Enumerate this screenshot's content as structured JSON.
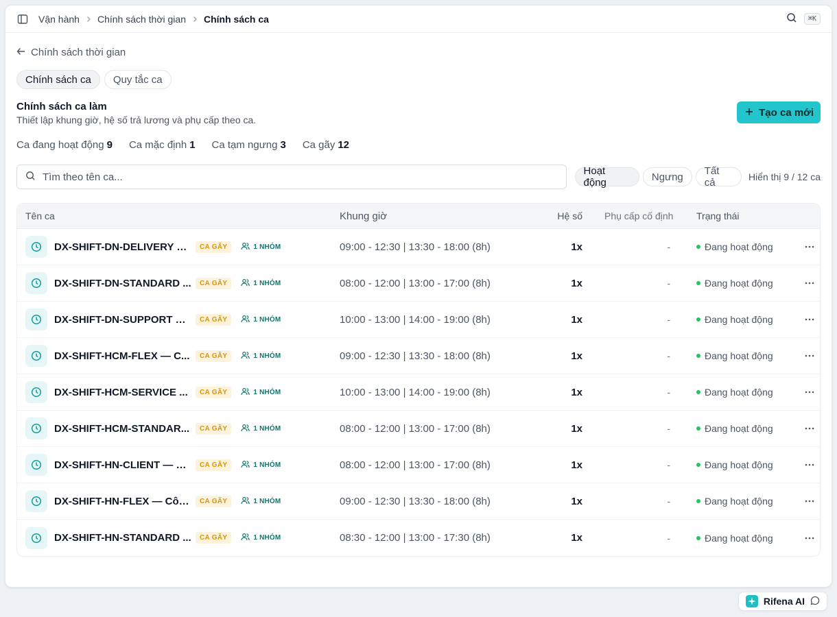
{
  "breadcrumb": [
    "Vận hành",
    "Chính sách thời gian",
    "Chính sách ca"
  ],
  "shortcut": "⌘K",
  "back_label": "Chính sách thời gian",
  "tabs": [
    {
      "label": "Chính sách ca",
      "active": true
    },
    {
      "label": "Quy tắc ca",
      "active": false
    }
  ],
  "page": {
    "title": "Chính sách ca làm",
    "subtitle": "Thiết lập khung giờ, hệ số trả lương và phụ cấp theo ca.",
    "create_label": "Tạo ca mới"
  },
  "stats": [
    {
      "label": "Ca đang hoạt động",
      "value": "9"
    },
    {
      "label": "Ca mặc định",
      "value": "1"
    },
    {
      "label": "Ca tạm ngưng",
      "value": "3"
    },
    {
      "label": "Ca gãy",
      "value": "12"
    }
  ],
  "search": {
    "placeholder": "Tìm theo tên ca..."
  },
  "filters": [
    {
      "label": "Hoạt động",
      "active": true
    },
    {
      "label": "Ngưng",
      "active": false
    },
    {
      "label": "Tất cả",
      "active": false
    }
  ],
  "showing": "Hiển thị 9 / 12 ca",
  "columns": {
    "name": "Tên ca",
    "time": "Khung giờ",
    "coef": "Hệ số",
    "allowance": "Phụ cấp cố định",
    "status": "Trạng thái"
  },
  "rows": [
    {
      "name": "DX-SHIFT-DN-DELIVERY —...",
      "badge": "CA GÃY",
      "group": "1 NHÓM",
      "time": "09:00 - 12:30 | 13:30 - 18:00 (8h)",
      "coef": "1x",
      "allowance": "-",
      "status": "Đang hoạt động"
    },
    {
      "name": "DX-SHIFT-DN-STANDARD ...",
      "badge": "CA GÃY",
      "group": "1 NHÓM",
      "time": "08:00 - 12:00 | 13:00 - 17:00 (8h)",
      "coef": "1x",
      "allowance": "-",
      "status": "Đang hoạt động"
    },
    {
      "name": "DX-SHIFT-DN-SUPPORT —...",
      "badge": "CA GÃY",
      "group": "1 NHÓM",
      "time": "10:00 - 13:00 | 14:00 - 19:00 (8h)",
      "coef": "1x",
      "allowance": "-",
      "status": "Đang hoạt động"
    },
    {
      "name": "DX-SHIFT-HCM-FLEX — C...",
      "badge": "CA GÃY",
      "group": "1 NHÓM",
      "time": "09:00 - 12:30 | 13:30 - 18:00 (8h)",
      "coef": "1x",
      "allowance": "-",
      "status": "Đang hoạt động"
    },
    {
      "name": "DX-SHIFT-HCM-SERVICE ...",
      "badge": "CA GÃY",
      "group": "1 NHÓM",
      "time": "10:00 - 13:00 | 14:00 - 19:00 (8h)",
      "coef": "1x",
      "allowance": "-",
      "status": "Đang hoạt động"
    },
    {
      "name": "DX-SHIFT-HCM-STANDAR...",
      "badge": "CA GÃY",
      "group": "1 NHÓM",
      "time": "08:00 - 12:00 | 13:00 - 17:00 (8h)",
      "coef": "1x",
      "allowance": "-",
      "status": "Đang hoạt động"
    },
    {
      "name": "DX-SHIFT-HN-CLIENT — Dị...",
      "badge": "CA GÃY",
      "group": "1 NHÓM",
      "time": "08:00 - 12:00 | 13:00 - 17:00 (8h)",
      "coef": "1x",
      "allowance": "-",
      "status": "Đang hoạt động"
    },
    {
      "name": "DX-SHIFT-HN-FLEX — Côn...",
      "badge": "CA GÃY",
      "group": "1 NHÓM",
      "time": "09:00 - 12:30 | 13:30 - 18:00 (8h)",
      "coef": "1x",
      "allowance": "-",
      "status": "Đang hoạt động"
    },
    {
      "name": "DX-SHIFT-HN-STANDARD ...",
      "badge": "CA GÃY",
      "group": "1 NHÓM",
      "time": "08:30 - 12:00 | 13:00 - 17:30 (8h)",
      "coef": "1x",
      "allowance": "-",
      "status": "Đang hoạt động"
    }
  ],
  "ai_assistant": {
    "label": "Rifena AI"
  },
  "colors": {
    "accent": "#22c5cb",
    "badge_bg": "#fdf3dc",
    "badge_text": "#d9950b",
    "group_text": "#0f766e",
    "status_dot": "#22c55e"
  },
  "icons": [
    "sidebar-toggle-icon",
    "chevron-right-icon",
    "search-icon",
    "arrow-left-icon",
    "plus-icon",
    "clock-icon",
    "users-icon",
    "more-horizontal-icon",
    "sparkle-icon",
    "chat-icon"
  ]
}
